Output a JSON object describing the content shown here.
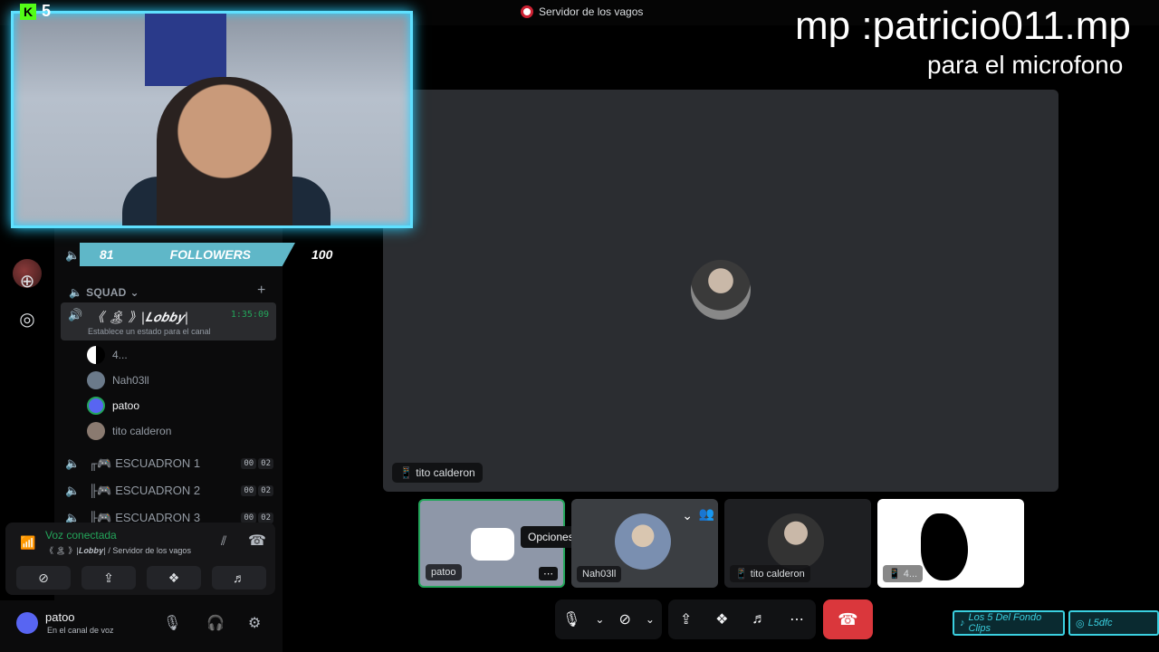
{
  "window": {
    "title": "Servidor de los vagos"
  },
  "stream_overlay": {
    "platform_count": "5",
    "followers": {
      "current": "81",
      "label": "FOLLOWERS",
      "goal": "100"
    },
    "mp_text": "mp :patricio011.mp",
    "mp_sub": "para el microfono",
    "social": [
      "Los 5 Del Fondo Clips",
      "L5dfc"
    ]
  },
  "sidebar": {
    "category": "SQUAD",
    "lobby": {
      "name": "《 🏝 》|𝑳𝒐𝒃𝒃𝒚|",
      "time": "1:35:09",
      "status": "Establece un estado para el canal"
    },
    "members": [
      "4...",
      "Nah03ll",
      "patoo",
      "tito calderon"
    ],
    "squads": [
      {
        "name": "╓🎮 ESCUADRON 1",
        "b1": "00",
        "b2": "02"
      },
      {
        "name": "╟🎮 ESCUADRON 2",
        "b1": "00",
        "b2": "02"
      },
      {
        "name": "╟🎮 ESCUADRON 3",
        "b1": "00",
        "b2": "02"
      }
    ],
    "voice": {
      "title": "Voz conectada",
      "sub": "《 🏝 》|𝑳𝒐𝒃𝒃𝒚| / Servidor de los vagos"
    },
    "user": {
      "name": "patoo",
      "status": "En el canal de voz"
    }
  },
  "stage": {
    "spotlight_label": "tito calderon",
    "tiles": [
      "patoo",
      "Nah03ll",
      "tito calderon",
      "4..."
    ],
    "tooltip": "Opciones"
  },
  "colors": {
    "accent_green": "#23a55a",
    "danger": "#da373c",
    "cam_border": "#5fe0ff"
  }
}
